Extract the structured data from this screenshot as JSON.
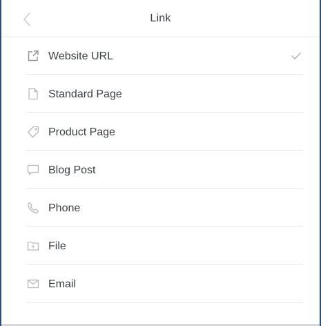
{
  "header": {
    "title": "Link"
  },
  "menu": {
    "items": [
      {
        "label": "Website URL",
        "icon": "external-link-icon",
        "selected": true
      },
      {
        "label": "Standard Page",
        "icon": "page-icon",
        "selected": false
      },
      {
        "label": "Product Page",
        "icon": "tag-icon",
        "selected": false
      },
      {
        "label": "Blog Post",
        "icon": "comment-icon",
        "selected": false
      },
      {
        "label": "Phone",
        "icon": "phone-icon",
        "selected": false
      },
      {
        "label": "File",
        "icon": "folder-icon",
        "selected": false
      },
      {
        "label": "Email",
        "icon": "envelope-icon",
        "selected": false
      }
    ]
  },
  "colors": {
    "text": "#3b3f45",
    "icon": "#b5b8bd",
    "divider": "#e6e6e6",
    "frame_border": "#2a4f7a"
  }
}
